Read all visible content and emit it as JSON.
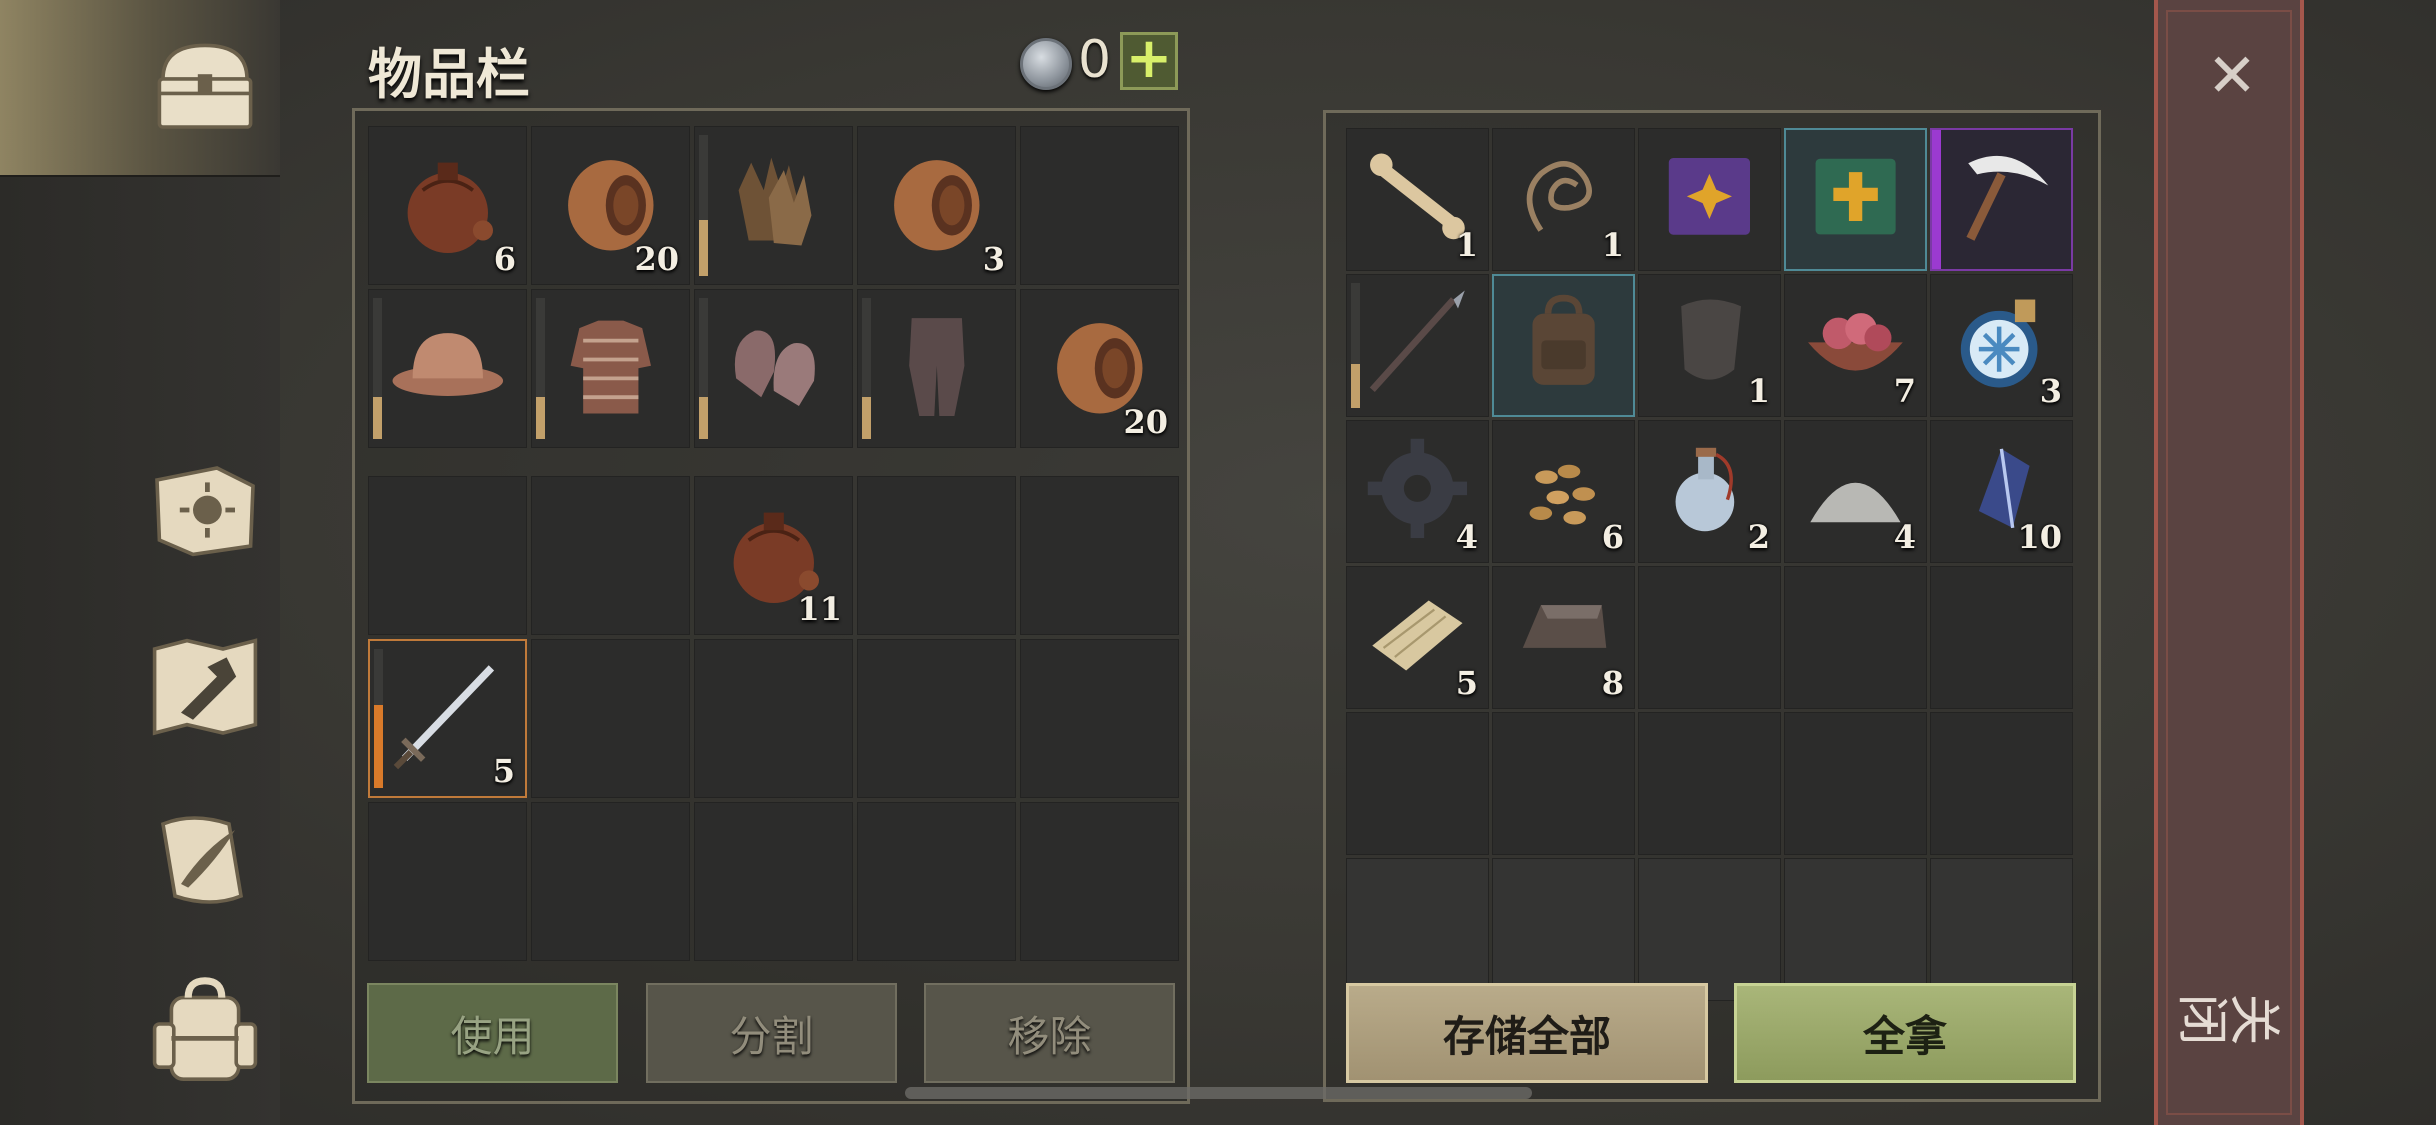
{
  "header": {
    "title": "物品栏",
    "coin_count": "0",
    "coin_add": "+"
  },
  "sidebar": {
    "items": [
      {
        "name": "chest-icon"
      },
      {
        "name": "sun-book-icon"
      },
      {
        "name": "hammer-map-icon"
      },
      {
        "name": "quill-scroll-icon"
      },
      {
        "name": "backpack-icon"
      }
    ]
  },
  "inventory": {
    "equip_slots": [
      {
        "icon": "flask-icon",
        "count": "6"
      },
      {
        "icon": "barrel-icon",
        "count": "20"
      },
      {
        "icon": "gloves-icon",
        "count": "",
        "durability": 0.4
      },
      {
        "icon": "barrel-icon",
        "count": "3"
      },
      {
        "icon": "",
        "count": ""
      },
      {
        "icon": "helmet-icon",
        "count": "",
        "durability": 0.3
      },
      {
        "icon": "chainmail-icon",
        "count": "",
        "durability": 0.3
      },
      {
        "icon": "mittens-icon",
        "count": "",
        "durability": 0.3
      },
      {
        "icon": "leggings-icon",
        "count": "",
        "durability": 0.3
      },
      {
        "icon": "barrel-icon",
        "count": "20"
      }
    ],
    "bag_slots": [
      {
        "icon": "",
        "count": ""
      },
      {
        "icon": "",
        "count": ""
      },
      {
        "icon": "flask-icon",
        "count": "11"
      },
      {
        "icon": "",
        "count": ""
      },
      {
        "icon": "",
        "count": ""
      },
      {
        "icon": "sword-icon",
        "count": "5",
        "durability": 0.6
      },
      {
        "icon": "",
        "count": ""
      },
      {
        "icon": "",
        "count": ""
      },
      {
        "icon": "",
        "count": ""
      },
      {
        "icon": "",
        "count": ""
      },
      {
        "icon": "",
        "count": ""
      },
      {
        "icon": "",
        "count": ""
      },
      {
        "icon": "",
        "count": ""
      },
      {
        "icon": "",
        "count": ""
      },
      {
        "icon": "",
        "count": ""
      }
    ],
    "buttons": {
      "use": "使用",
      "split": "分割",
      "remove": "移除"
    }
  },
  "storage": {
    "slots": [
      {
        "icon": "bone-icon",
        "count": "1"
      },
      {
        "icon": "rope-icon",
        "count": "1"
      },
      {
        "icon": "purple-book-icon",
        "count": ""
      },
      {
        "icon": "green-book-icon",
        "count": ""
      },
      {
        "icon": "pickaxe-icon",
        "count": ""
      },
      {
        "icon": "spear-icon",
        "count": "",
        "durability": 0.35
      },
      {
        "icon": "leather-backpack-icon",
        "count": ""
      },
      {
        "icon": "shield-plate-icon",
        "count": "1"
      },
      {
        "icon": "meat-bowl-icon",
        "count": "7"
      },
      {
        "icon": "frost-potion-icon",
        "count": "3"
      },
      {
        "icon": "gear-icon",
        "count": "4"
      },
      {
        "icon": "seeds-icon",
        "count": "6"
      },
      {
        "icon": "potion-bottle-icon",
        "count": "2"
      },
      {
        "icon": "salt-pile-icon",
        "count": "4"
      },
      {
        "icon": "crystal-icon",
        "count": "10"
      },
      {
        "icon": "wood-plank-icon",
        "count": "5"
      },
      {
        "icon": "iron-ingot-icon",
        "count": "8"
      },
      {
        "icon": "",
        "count": ""
      },
      {
        "icon": "",
        "count": ""
      },
      {
        "icon": "",
        "count": ""
      },
      {
        "icon": "",
        "count": ""
      },
      {
        "icon": "",
        "count": ""
      },
      {
        "icon": "",
        "count": ""
      },
      {
        "icon": "",
        "count": ""
      },
      {
        "icon": "",
        "count": ""
      },
      {
        "icon": "",
        "count": ""
      },
      {
        "icon": "",
        "count": ""
      },
      {
        "icon": "",
        "count": ""
      },
      {
        "icon": "",
        "count": ""
      },
      {
        "icon": "",
        "count": ""
      }
    ],
    "buttons": {
      "store_all": "存储全部",
      "take_all": "全拿"
    }
  },
  "close": {
    "label": "关闭",
    "x": "✕"
  }
}
